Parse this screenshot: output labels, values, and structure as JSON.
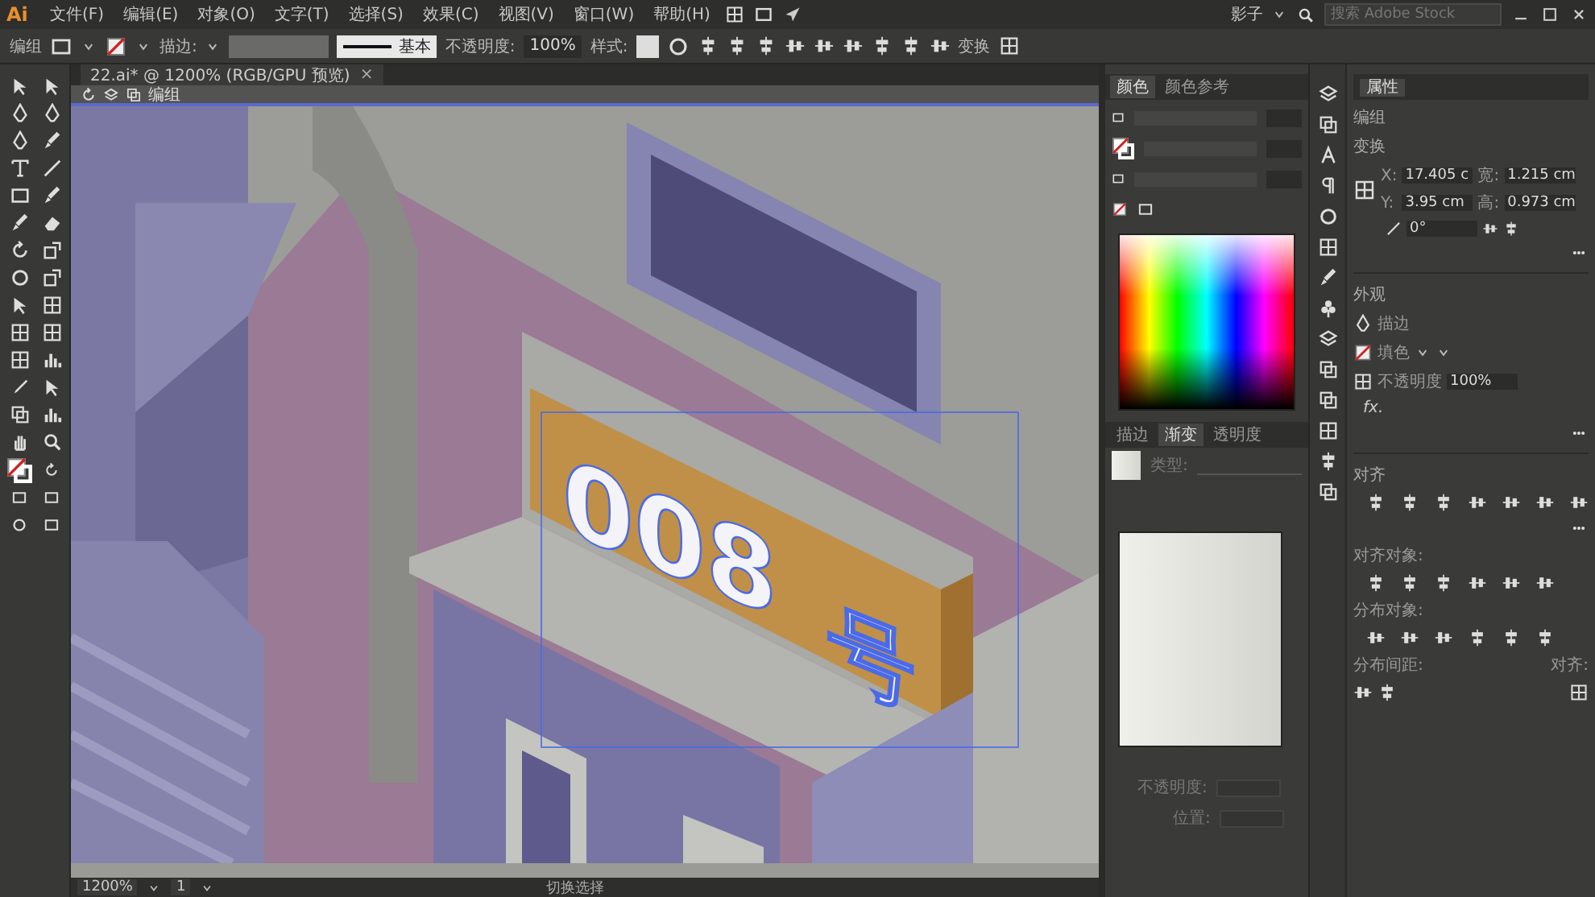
{
  "app": {
    "logo": "Ai",
    "menus": [
      "文件(F)",
      "编辑(E)",
      "对象(O)",
      "文字(T)",
      "选择(S)",
      "效果(C)",
      "视图(V)",
      "窗口(W)",
      "帮助(H)"
    ],
    "workspace": "影子",
    "stock_search": {
      "placeholder": "搜索 Adobe Stock"
    }
  },
  "control_bar": {
    "selection": "编组",
    "stroke_label": "描边:",
    "stroke_style": "基本",
    "opacity_label": "不透明度:",
    "opacity": "100%",
    "style_label": "样式:",
    "transform": "变换"
  },
  "document_tab": {
    "title": "22.ai* @ 1200% (RGB/GPU 预览)",
    "close": "×"
  },
  "breadcrumb": {
    "group": "编组"
  },
  "canvas": {
    "sign_digits": "008",
    "sign_char": "号"
  },
  "color_panel": {
    "tabs": [
      {
        "label": "颜色",
        "selected": true
      },
      {
        "label": "颜色参考",
        "selected": false
      }
    ]
  },
  "gradient_panel": {
    "tabs": [
      {
        "label": "描边",
        "selected": false
      },
      {
        "label": "渐变",
        "selected": true
      },
      {
        "label": "透明度",
        "selected": false
      }
    ],
    "type_label": "类型:",
    "opacity_label": "不透明度:",
    "location_label": "位置:"
  },
  "properties": {
    "tab": "属性",
    "selection": "编组",
    "transform_title": "变换",
    "x_label": "X:",
    "x": "17.405 c",
    "w_label": "宽:",
    "w": "1.215 cm",
    "y_label": "Y:",
    "y": "3.95 cm",
    "h_label": "高:",
    "h": "0.973 cm",
    "angle": "0°",
    "appearance_title": "外观",
    "stroke_label": "描边",
    "fill_label": "填色",
    "opacity_label": "不透明度",
    "opacity": "100%",
    "fx": "fx.",
    "align_title": "对齐",
    "align_objects": "对齐对象:",
    "distribute_objects": "分布对象:",
    "distribute_spacing": "分布间距:",
    "align_to": "对齐:"
  },
  "status_bar": {
    "zoom": "1200%",
    "artboard": "1",
    "tool": "切换选择"
  }
}
